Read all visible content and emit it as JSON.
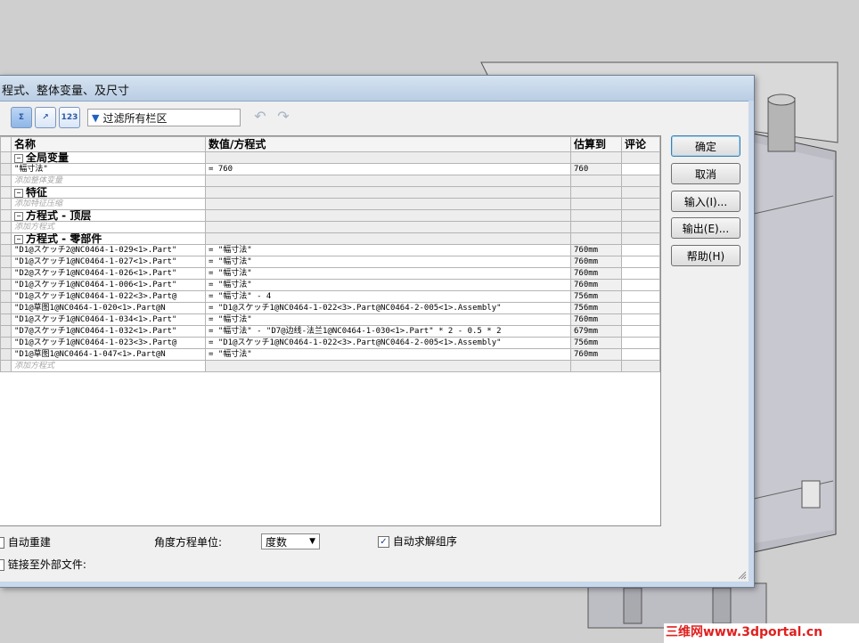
{
  "dialog": {
    "title": "程式、整体变量、及尺寸"
  },
  "toolbar": {
    "filter_text": "过滤所有栏区",
    "btn1": "Σ",
    "btn2": "↗",
    "btn3": "123"
  },
  "grid": {
    "columns": [
      "名称",
      "数值/方程式",
      "估算到",
      "评论"
    ],
    "sections": {
      "global": "全局变量",
      "features": "特征",
      "eq_top": "方程式 - 顶层",
      "eq_parts": "方程式 - 零部件"
    },
    "global_row": {
      "name": "\"幅寸法\"",
      "value": "= 760",
      "est": "760"
    },
    "add_global": "添加整体变量",
    "add_feature": "添加特征压缩",
    "add_eq_top": "添加方程式",
    "add_eq_parts": "添加方程式",
    "part_rows": [
      {
        "name": "\"D1@スケッチ2@NC0464-1-029<1>.Part\"",
        "value": "= \"幅寸法\"",
        "est": "760mm"
      },
      {
        "name": "\"D1@スケッチ1@NC0464-1-027<1>.Part\"",
        "value": "= \"幅寸法\"",
        "est": "760mm"
      },
      {
        "name": "\"D2@スケッチ1@NC0464-1-026<1>.Part\"",
        "value": "= \"幅寸法\"",
        "est": "760mm"
      },
      {
        "name": "\"D1@スケッチ1@NC0464-1-006<1>.Part\"",
        "value": "= \"幅寸法\"",
        "est": "760mm"
      },
      {
        "name": "\"D1@スケッチ1@NC0464-1-022<3>.Part@",
        "value": "= \"幅寸法\" - 4",
        "est": "756mm"
      },
      {
        "name": "\"D1@草图1@NC0464-1-020<1>.Part@N",
        "value": "= \"D1@スケッチ1@NC0464-1-022<3>.Part@NC0464-2-005<1>.Assembly\"",
        "est": "756mm"
      },
      {
        "name": "\"D1@スケッチ1@NC0464-1-034<1>.Part\"",
        "value": "= \"幅寸法\"",
        "est": "760mm"
      },
      {
        "name": "\"D7@スケッチ1@NC0464-1-032<1>.Part\"",
        "value": "= \"幅寸法\" - \"D7@边线-法兰1@NC0464-1-030<1>.Part\" * 2 - 0.5 * 2",
        "est": "679mm"
      },
      {
        "name": "\"D1@スケッチ1@NC0464-1-023<3>.Part@",
        "value": "= \"D1@スケッチ1@NC0464-1-022<3>.Part@NC0464-2-005<1>.Assembly\"",
        "est": "756mm"
      },
      {
        "name": "\"D1@草图1@NC0464-1-047<1>.Part@N",
        "value": "= \"幅寸法\"",
        "est": "760mm"
      }
    ]
  },
  "buttons": {
    "ok": "确定",
    "cancel": "取消",
    "import": "输入(I)...",
    "export": "输出(E)...",
    "help": "帮助(H)"
  },
  "bottom": {
    "auto_rebuild": "自动重建",
    "link_external": "链接至外部文件:",
    "angle_unit_label": "角度方程单位:",
    "angle_unit_value": "度数",
    "auto_solve": "自动求解组序",
    "auto_solve_checked": true,
    "auto_rebuild_checked": false,
    "link_external_checked": false
  },
  "watermark": "三维网www.3dportal.cn"
}
